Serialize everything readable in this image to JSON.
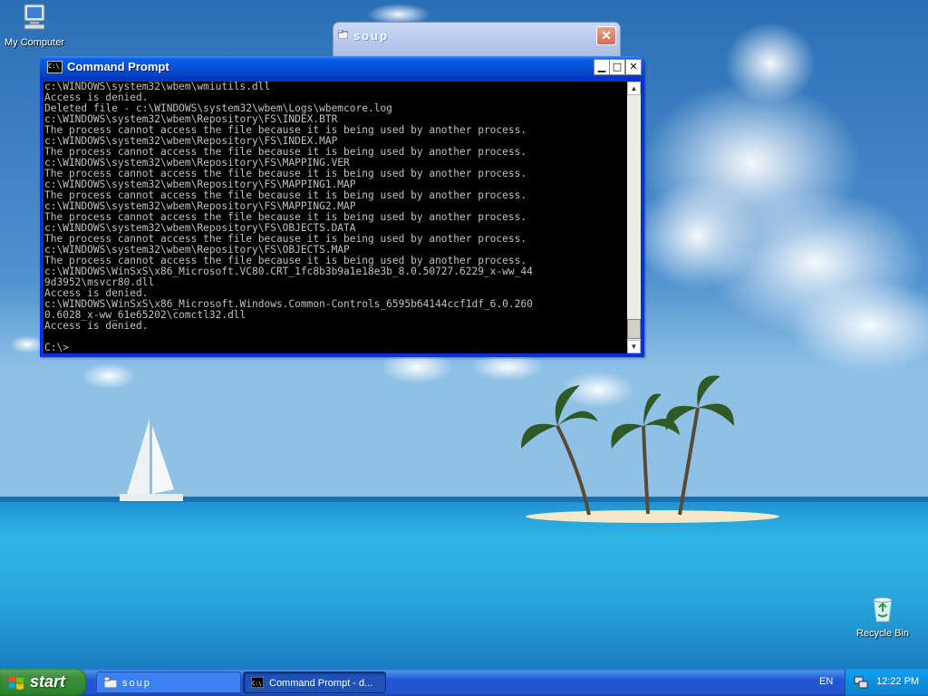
{
  "desktop": {
    "icons": [
      {
        "label": "My Computer"
      },
      {
        "label": "Recycle Bin"
      }
    ]
  },
  "windows": {
    "soup": {
      "title": "soup",
      "close_glyph": "✕"
    },
    "cmd": {
      "title": "Command Prompt",
      "buttons": {
        "minimize": "▁",
        "maximize": "□",
        "close": "✕"
      },
      "output_lines": [
        "c:\\WINDOWS\\system32\\wbem\\wmiutils.dll",
        "Access is denied.",
        "Deleted file - c:\\WINDOWS\\system32\\wbem\\Logs\\wbemcore.log",
        "c:\\WINDOWS\\system32\\wbem\\Repository\\FS\\INDEX.BTR",
        "The process cannot access the file because it is being used by another process.",
        "c:\\WINDOWS\\system32\\wbem\\Repository\\FS\\INDEX.MAP",
        "The process cannot access the file because it is being used by another process.",
        "c:\\WINDOWS\\system32\\wbem\\Repository\\FS\\MAPPING.VER",
        "The process cannot access the file because it is being used by another process.",
        "c:\\WINDOWS\\system32\\wbem\\Repository\\FS\\MAPPING1.MAP",
        "The process cannot access the file because it is being used by another process.",
        "c:\\WINDOWS\\system32\\wbem\\Repository\\FS\\MAPPING2.MAP",
        "The process cannot access the file because it is being used by another process.",
        "c:\\WINDOWS\\system32\\wbem\\Repository\\FS\\OBJECTS.DATA",
        "The process cannot access the file because it is being used by another process.",
        "c:\\WINDOWS\\system32\\wbem\\Repository\\FS\\OBJECTS.MAP",
        "The process cannot access the file because it is being used by another process.",
        "c:\\WINDOWS\\WinSxS\\x86_Microsoft.VC80.CRT_1fc8b3b9a1e18e3b_8.0.50727.6229_x-ww_44",
        "9d3952\\msvcr80.dll",
        "Access is denied.",
        "c:\\WINDOWS\\WinSxS\\x86_Microsoft.Windows.Common-Controls_6595b64144ccf1df_6.0.260",
        "0.6028_x-ww_61e65202\\comctl32.dll",
        "Access is denied."
      ],
      "prompt": "C:\\>"
    }
  },
  "taskbar": {
    "start_label": "start",
    "tasks": [
      {
        "label": "soup"
      },
      {
        "label": "Command Prompt - d..."
      }
    ],
    "language": "EN",
    "clock": "12:22 PM"
  },
  "colors": {
    "xp_blue_titlebar": "#0552d8",
    "start_green": "#3f8e3f",
    "console_bg": "#000000",
    "console_fg": "#c0c0c0"
  }
}
